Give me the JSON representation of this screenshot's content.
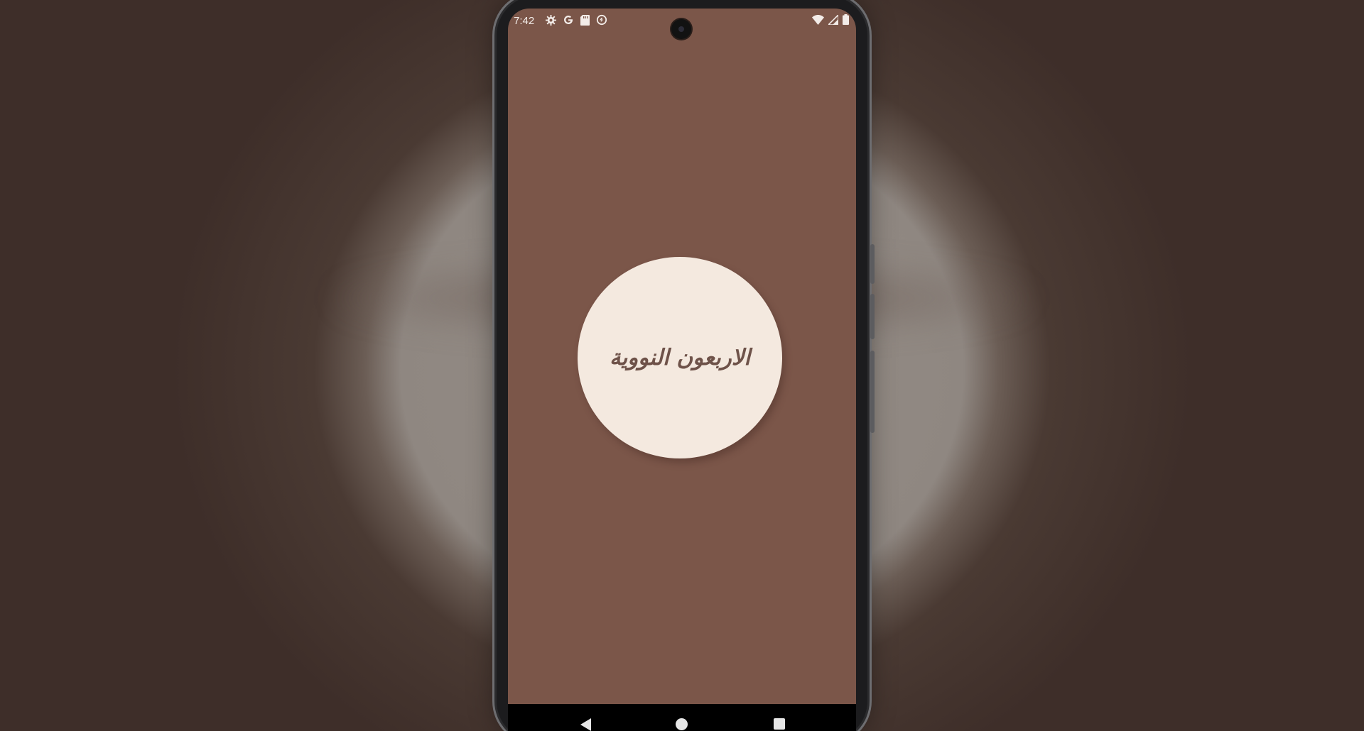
{
  "status_bar": {
    "time": "7:42",
    "left_icons": [
      "settings-icon",
      "google-icon",
      "sd-card-icon",
      "data-saver-icon"
    ],
    "right_icons": [
      "wifi-icon",
      "cell-signal-icon",
      "battery-icon"
    ]
  },
  "splash": {
    "title": "الاربعون النووية"
  },
  "navigation": {
    "buttons": [
      "back-icon",
      "home-icon",
      "recents-icon"
    ]
  },
  "colors": {
    "screen_background": "#7b5649",
    "circle_fill": "#f4e9df",
    "title_text": "#6e5249"
  }
}
